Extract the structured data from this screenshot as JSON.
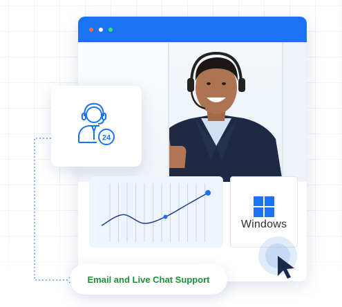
{
  "window": {
    "title_dots": [
      "close",
      "minimize",
      "maximize"
    ],
    "titlebar_color": "#1b73f3"
  },
  "hero_photo": {
    "description_icon": "support-agent-photo"
  },
  "support_card": {
    "icon": "headset-agent-24-icon",
    "badge_text": "24"
  },
  "chart": {
    "type": "line",
    "accent_color": "#1b73f3"
  },
  "windows_card": {
    "label": "Windows",
    "icon": "windows-logo-icon",
    "logo_color": "#1b73f3"
  },
  "support_pill": {
    "label": "Email and Live Chat Support",
    "text_color": "#1e8f3a"
  },
  "chart_data": {
    "type": "line",
    "title": "",
    "xlabel": "",
    "ylabel": "",
    "points": [
      [
        0,
        20
      ],
      [
        1,
        40
      ],
      [
        2,
        24
      ],
      [
        3,
        36
      ],
      [
        4,
        58
      ],
      [
        5,
        80
      ]
    ]
  }
}
